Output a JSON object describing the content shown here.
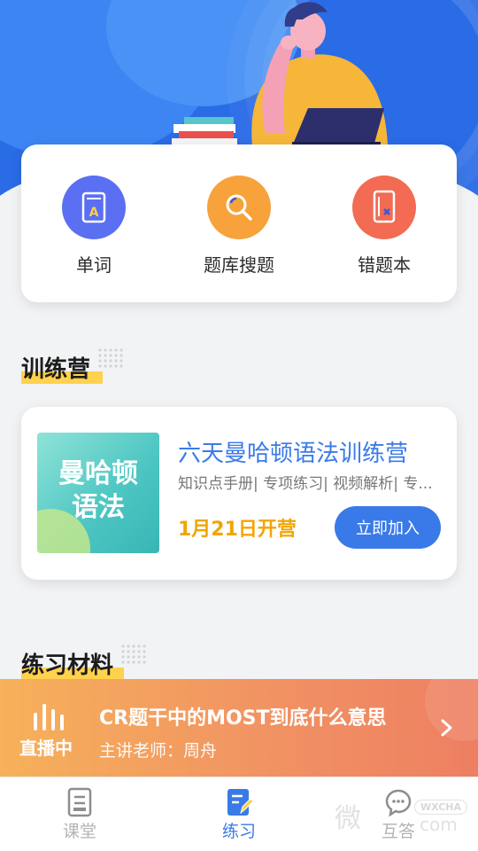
{
  "quick_actions": [
    {
      "label": "单词",
      "icon": "vocabulary-book-icon",
      "color": "#5b6ff2"
    },
    {
      "label": "题库搜题",
      "icon": "search-icon",
      "color": "#f7a23a"
    },
    {
      "label": "错题本",
      "icon": "mistake-notebook-icon",
      "color": "#f26b52"
    }
  ],
  "camp_section": {
    "title": "训练营"
  },
  "camp": {
    "cover_text_line1": "曼哈顿",
    "cover_text_line2": "语法",
    "title": "六天曼哈顿语法训练营",
    "subtitle": "知识点手册| 专项练习| 视频解析| 专...",
    "date": "1月21日开营",
    "join_label": "立即加入"
  },
  "materials_section": {
    "title": "练习材料"
  },
  "live": {
    "status": "直播中",
    "title": "CR题干中的MOST到底什么意思",
    "teacher": "主讲老师：周舟"
  },
  "bottom_nav": [
    {
      "label": "课堂",
      "icon": "classroom-icon",
      "active": false
    },
    {
      "label": "练习",
      "icon": "practice-icon",
      "active": true
    },
    {
      "label": "互答",
      "icon": "qa-chat-icon",
      "active": false
    }
  ],
  "watermark": {
    "text": "微",
    "brand": "WXCHA",
    "suffix": "com"
  },
  "colors": {
    "accent": "#3a7ae8",
    "highlight": "#ffd24d",
    "date": "#f2a500"
  }
}
